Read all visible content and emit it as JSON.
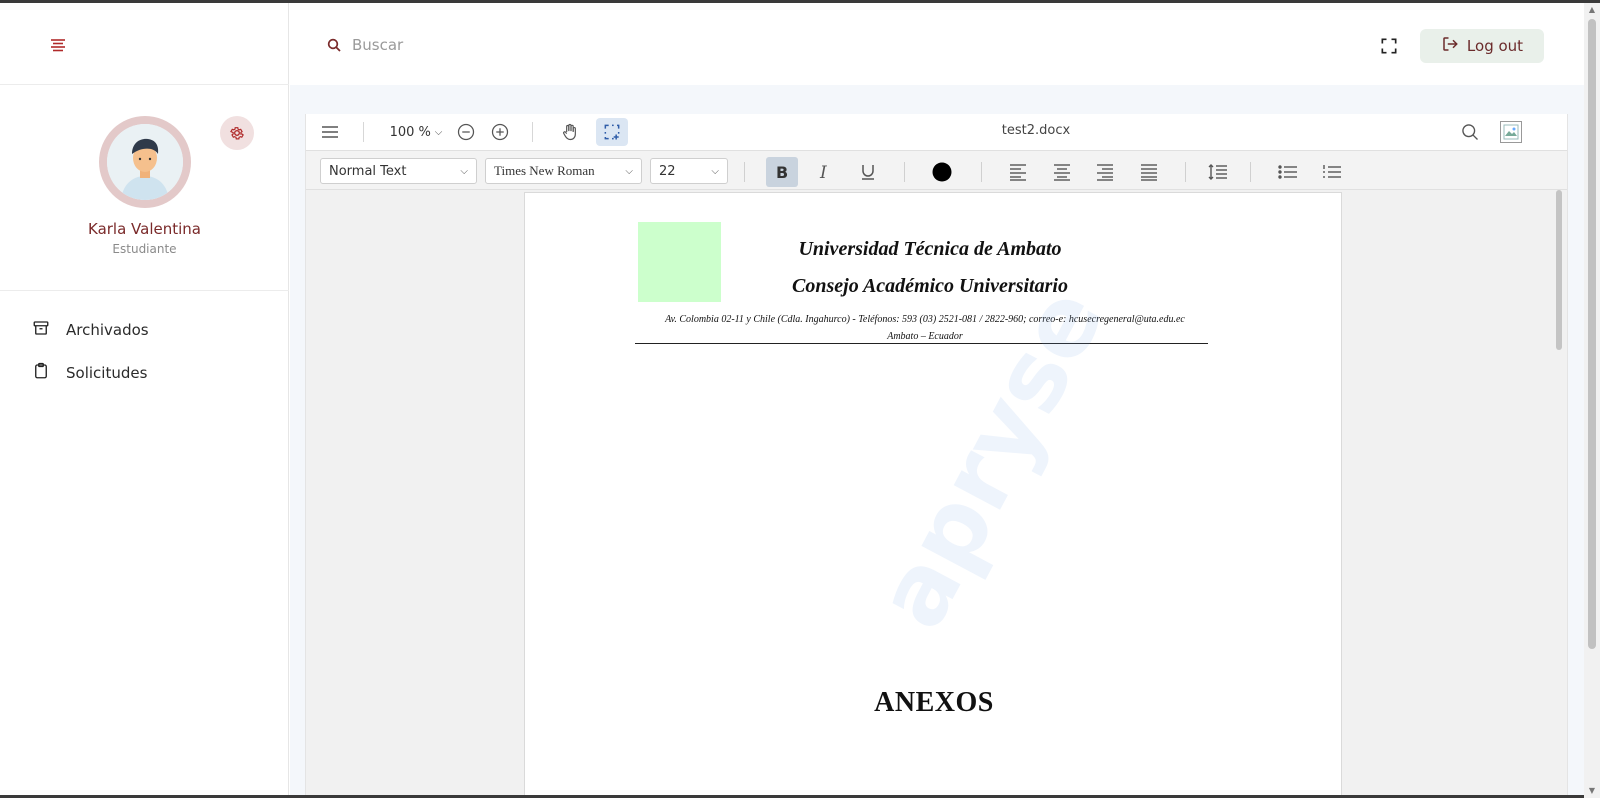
{
  "app": {
    "search": {
      "placeholder": "Buscar"
    },
    "logout_label": "Log out"
  },
  "user": {
    "name": "Karla Valentina",
    "role": "Estudiante"
  },
  "sidebar": {
    "items": [
      {
        "label": "Archivados",
        "icon": "archive-icon"
      },
      {
        "label": "Solicitudes",
        "icon": "clipboard-icon"
      }
    ]
  },
  "viewer": {
    "zoom": "100",
    "zoom_unit": "%",
    "file_name": "test2.docx",
    "format": {
      "paragraph_style": "Normal Text",
      "font_family": "Times New Roman",
      "font_size": "22",
      "text_color": "#000000"
    }
  },
  "document": {
    "title_line1": "Universidad Técnica de Ambato",
    "title_line2": "Consejo Académico Universitario",
    "address_line1": "Av. Colombia 02-11 y Chile (Cdla. Ingahurco) - Teléfonos: 593 (03) 2521-081 / 2822-960; correo-e: hcusecregeneral@uta.edu.ec",
    "address_line2": "Ambato – Ecuador",
    "heading": "ANEXOS",
    "watermark": "apryse"
  },
  "colors": {
    "accent": "#7a2a2a",
    "logout_bg": "#e9f0ea",
    "logo_placeholder": "#ccffcc"
  }
}
